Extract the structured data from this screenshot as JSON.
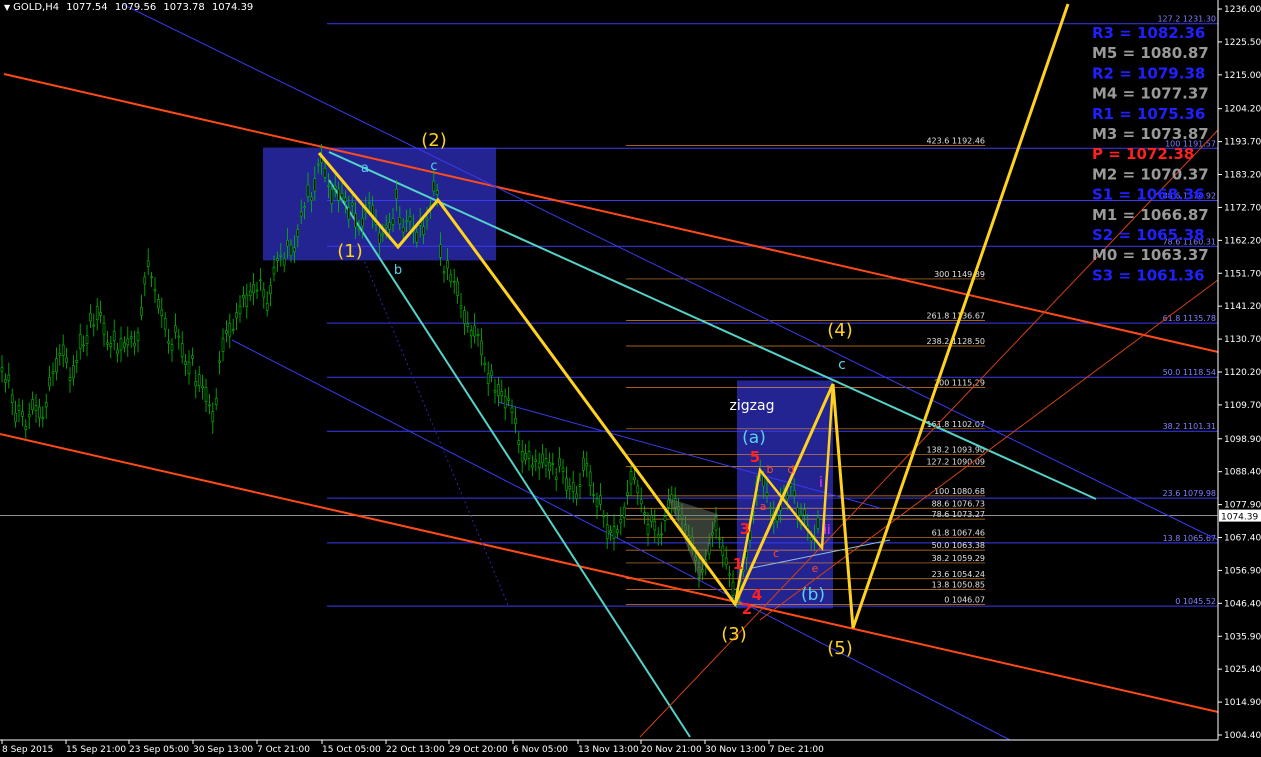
{
  "header": {
    "symbol": "GOLD,H4",
    "open": "1077.54",
    "high": "1079.56",
    "low": "1073.78",
    "close": "1074.39"
  },
  "colors": {
    "background": "#000000",
    "candle": "#00c000",
    "wave_line": "#ffd21e",
    "channel_red": "#ff4a1a",
    "channel_cyan": "#55d2c8",
    "fib_line": "#3a3af0",
    "fib_orange": "#ff9b30",
    "pivot_blue": "#2020ff",
    "pivot_grey": "#9a9a9a",
    "pivot_red": "#ff2020",
    "box": "#232391"
  },
  "chart_data": {
    "type": "candlestick",
    "instrument": "GOLD",
    "timeframe": "H4",
    "ylim": [
      1004.4,
      1236.0
    ],
    "y_ticks": [
      "1236.00",
      "1225.50",
      "1215.00",
      "1204.20",
      "1193.70",
      "1183.20",
      "1172.70",
      "1162.20",
      "1151.70",
      "1141.20",
      "1130.70",
      "1120.20",
      "1109.70",
      "1098.90",
      "1088.40",
      "1077.90",
      "1067.40",
      "1056.90",
      "1046.40",
      "1035.90",
      "1025.40",
      "1014.90",
      "1004.40"
    ],
    "current_price": "1074.39",
    "x_ticks": [
      "8 Sep 2015",
      "15 Sep 21:00",
      "23 Sep 05:00",
      "30 Sep 13:00",
      "7 Oct 21:00",
      "15 Oct 05:00",
      "22 Oct 13:00",
      "29 Oct 20:00",
      "6 Nov 05:00",
      "13 Nov 13:00",
      "20 Nov 21:00",
      "30 Nov 13:00",
      "7 Dec 21:00"
    ],
    "price_path": [
      [
        0,
        1126
      ],
      [
        4,
        1116
      ],
      [
        8,
        1120
      ],
      [
        12,
        1112
      ],
      [
        16,
        1105
      ],
      [
        20,
        1110
      ],
      [
        26,
        1102
      ],
      [
        32,
        1110
      ],
      [
        38,
        1108
      ],
      [
        44,
        1105
      ],
      [
        50,
        1118
      ],
      [
        56,
        1122
      ],
      [
        62,
        1128
      ],
      [
        66,
        1125
      ],
      [
        70,
        1118
      ],
      [
        76,
        1122
      ],
      [
        80,
        1130
      ],
      [
        86,
        1128
      ],
      [
        90,
        1138
      ],
      [
        94,
        1135
      ],
      [
        98,
        1140
      ],
      [
        102,
        1138
      ],
      [
        106,
        1130
      ],
      [
        110,
        1128
      ],
      [
        114,
        1132
      ],
      [
        118,
        1126
      ],
      [
        122,
        1130
      ],
      [
        126,
        1128
      ],
      [
        130,
        1132
      ],
      [
        136,
        1128
      ],
      [
        140,
        1135
      ],
      [
        144,
        1148
      ],
      [
        148,
        1155
      ],
      [
        152,
        1150
      ],
      [
        156,
        1145
      ],
      [
        160,
        1140
      ],
      [
        164,
        1138
      ],
      [
        168,
        1130
      ],
      [
        172,
        1128
      ],
      [
        176,
        1135
      ],
      [
        180,
        1130
      ],
      [
        184,
        1125
      ],
      [
        188,
        1120
      ],
      [
        192,
        1126
      ],
      [
        196,
        1116
      ],
      [
        200,
        1118
      ],
      [
        204,
        1114
      ],
      [
        208,
        1112
      ],
      [
        212,
        1105
      ],
      [
        216,
        1110
      ],
      [
        220,
        1125
      ],
      [
        224,
        1130
      ],
      [
        228,
        1135
      ],
      [
        232,
        1132
      ],
      [
        236,
        1138
      ],
      [
        240,
        1140
      ],
      [
        244,
        1145
      ],
      [
        248,
        1142
      ],
      [
        252,
        1148
      ],
      [
        256,
        1145
      ],
      [
        260,
        1150
      ],
      [
        264,
        1145
      ],
      [
        268,
        1140
      ],
      [
        272,
        1150
      ],
      [
        276,
        1155
      ],
      [
        280,
        1158
      ],
      [
        284,
        1155
      ],
      [
        288,
        1162
      ],
      [
        292,
        1158
      ],
      [
        296,
        1160
      ],
      [
        300,
        1170
      ],
      [
        304,
        1172
      ],
      [
        308,
        1178
      ],
      [
        312,
        1175
      ],
      [
        316,
        1182
      ],
      [
        320,
        1190
      ],
      [
        324,
        1185
      ],
      [
        328,
        1180
      ],
      [
        332,
        1176
      ],
      [
        336,
        1180
      ],
      [
        340,
        1175
      ],
      [
        344,
        1178
      ],
      [
        348,
        1170
      ],
      [
        352,
        1174
      ],
      [
        356,
        1168
      ],
      [
        360,
        1165
      ],
      [
        364,
        1170
      ],
      [
        368,
        1175
      ],
      [
        372,
        1172
      ],
      [
        376,
        1168
      ],
      [
        380,
        1162
      ],
      [
        384,
        1165
      ],
      [
        388,
        1168
      ],
      [
        392,
        1165
      ],
      [
        396,
        1178
      ],
      [
        400,
        1168
      ],
      [
        404,
        1165
      ],
      [
        408,
        1170
      ],
      [
        412,
        1168
      ],
      [
        416,
        1162
      ],
      [
        420,
        1168
      ],
      [
        424,
        1165
      ],
      [
        428,
        1170
      ],
      [
        432,
        1175
      ],
      [
        436,
        1185
      ],
      [
        440,
        1160
      ],
      [
        444,
        1152
      ],
      [
        448,
        1155
      ],
      [
        452,
        1148
      ],
      [
        456,
        1150
      ],
      [
        460,
        1142
      ],
      [
        464,
        1138
      ],
      [
        468,
        1135
      ],
      [
        472,
        1132
      ],
      [
        476,
        1134
      ],
      [
        480,
        1130
      ],
      [
        484,
        1124
      ],
      [
        488,
        1118
      ],
      [
        492,
        1120
      ],
      [
        496,
        1112
      ],
      [
        500,
        1116
      ],
      [
        504,
        1110
      ],
      [
        508,
        1112
      ],
      [
        512,
        1108
      ],
      [
        516,
        1104
      ],
      [
        520,
        1095
      ],
      [
        524,
        1092
      ],
      [
        528,
        1095
      ],
      [
        532,
        1090
      ],
      [
        536,
        1092
      ],
      [
        540,
        1090
      ],
      [
        544,
        1094
      ],
      [
        548,
        1089
      ],
      [
        552,
        1092
      ],
      [
        556,
        1086
      ],
      [
        560,
        1092
      ],
      [
        564,
        1088
      ],
      [
        568,
        1082
      ],
      [
        572,
        1085
      ],
      [
        576,
        1080
      ],
      [
        580,
        1084
      ],
      [
        584,
        1092
      ],
      [
        588,
        1090
      ],
      [
        592,
        1083
      ],
      [
        596,
        1078
      ],
      [
        600,
        1080
      ],
      [
        604,
        1074
      ],
      [
        608,
        1068
      ],
      [
        612,
        1070
      ],
      [
        616,
        1068
      ],
      [
        620,
        1072
      ],
      [
        624,
        1075
      ],
      [
        628,
        1082
      ],
      [
        632,
        1088
      ],
      [
        636,
        1085
      ],
      [
        640,
        1080
      ],
      [
        644,
        1076
      ],
      [
        648,
        1070
      ],
      [
        652,
        1074
      ],
      [
        656,
        1070
      ],
      [
        660,
        1066
      ],
      [
        664,
        1072
      ],
      [
        668,
        1078
      ],
      [
        672,
        1080
      ],
      [
        676,
        1078
      ],
      [
        680,
        1076
      ],
      [
        684,
        1072
      ],
      [
        688,
        1068
      ],
      [
        692,
        1066
      ],
      [
        696,
        1060
      ],
      [
        700,
        1055
      ],
      [
        704,
        1058
      ],
      [
        708,
        1062
      ],
      [
        712,
        1068
      ],
      [
        716,
        1072
      ],
      [
        720,
        1066
      ],
      [
        724,
        1062
      ],
      [
        728,
        1058
      ],
      [
        732,
        1052
      ],
      [
        736,
        1048
      ],
      [
        740,
        1052
      ],
      [
        744,
        1058
      ],
      [
        748,
        1064
      ],
      [
        752,
        1072
      ],
      [
        756,
        1082
      ],
      [
        760,
        1088
      ],
      [
        764,
        1085
      ],
      [
        768,
        1080
      ],
      [
        772,
        1075
      ],
      [
        776,
        1072
      ],
      [
        780,
        1077
      ],
      [
        784,
        1082
      ],
      [
        788,
        1080
      ],
      [
        792,
        1086
      ],
      [
        796,
        1078
      ],
      [
        800,
        1072
      ],
      [
        804,
        1076
      ],
      [
        808,
        1070
      ],
      [
        812,
        1066
      ],
      [
        816,
        1068
      ],
      [
        820,
        1076
      ],
      [
        822,
        1078
      ]
    ],
    "waves": [
      {
        "label": "(1)",
        "color": "#ffd21e"
      },
      {
        "label": "(2)",
        "color": "#ffd21e"
      },
      {
        "label": "(3)",
        "color": "#ffd21e"
      },
      {
        "label": "(4)",
        "color": "#ffd21e"
      },
      {
        "label": "(5)",
        "color": "#ffd21e"
      },
      {
        "label": "a",
        "color": "#55d2f0"
      },
      {
        "label": "b",
        "color": "#55d2f0"
      },
      {
        "label": "c",
        "color": "#55d2f0"
      },
      {
        "label": "c",
        "color": "#55d2f0"
      },
      {
        "label": "(a)",
        "color": "#55d2f0"
      },
      {
        "label": "(b)",
        "color": "#55d2f0"
      },
      {
        "label": "zigzag",
        "color": "#ffffff"
      },
      {
        "label": "1",
        "color": "#ff2020"
      },
      {
        "label": "2",
        "color": "#ff2020"
      },
      {
        "label": "3",
        "color": "#ff2020"
      },
      {
        "label": "4",
        "color": "#ff2020"
      },
      {
        "label": "5",
        "color": "#ff2020"
      },
      {
        "label": "a",
        "color": "#ff4a2a"
      },
      {
        "label": "b",
        "color": "#ff4a2a"
      },
      {
        "label": "c",
        "color": "#ff4a2a"
      },
      {
        "label": "d",
        "color": "#ff4a2a"
      },
      {
        "label": "e",
        "color": "#ff4a2a"
      },
      {
        "label": "i",
        "color": "#ff30ff"
      },
      {
        "label": "ii",
        "color": "#ff30ff"
      }
    ],
    "fib_right": [
      {
        "label": "127.2 1231.30",
        "price": 1231.3
      },
      {
        "label": "100 1191.57",
        "price": 1191.57
      },
      {
        "label": "88.6 1174.92",
        "price": 1174.92
      },
      {
        "label": "78.6 1160.31",
        "price": 1160.31
      },
      {
        "label": "61.8 1135.78",
        "price": 1135.78
      },
      {
        "label": "50.0 1118.54",
        "price": 1118.54
      },
      {
        "label": "38.2 1101.31",
        "price": 1101.31
      },
      {
        "label": "23.6 1079.98",
        "price": 1079.98
      },
      {
        "label": "13.8 1065.67",
        "price": 1065.67
      },
      {
        "label": "0 1045.52",
        "price": 1045.52
      }
    ],
    "fib_mid": [
      {
        "label": "423.6 1192.46",
        "price": 1192.46
      },
      {
        "label": "300 1149.89",
        "price": 1149.89
      },
      {
        "label": "261.8 1136.67",
        "price": 1136.67
      },
      {
        "label": "238.2 1128.50",
        "price": 1128.5
      },
      {
        "label": "200 1115.29",
        "price": 1115.29
      },
      {
        "label": "161.8 1102.07",
        "price": 1102.07
      },
      {
        "label": "138.2 1093.90",
        "price": 1093.9
      },
      {
        "label": "127.2 1090.09",
        "price": 1090.09
      },
      {
        "label": "100 1080.68",
        "price": 1080.68
      },
      {
        "label": "88.6 1076.73",
        "price": 1076.73
      },
      {
        "label": "78.6 1073.27",
        "price": 1073.27
      },
      {
        "label": "61.8 1067.46",
        "price": 1067.46
      },
      {
        "label": "50.0 1063.38",
        "price": 1063.38
      },
      {
        "label": "38.2 1059.29",
        "price": 1059.29
      },
      {
        "label": "23.6 1054.24",
        "price": 1054.24
      },
      {
        "label": "13.8 1050.85",
        "price": 1050.85
      },
      {
        "label": "0 1046.07",
        "price": 1046.07
      }
    ],
    "pivots": [
      {
        "label": "R3 = 1082.36",
        "color": "#2020ff"
      },
      {
        "label": "M5 = 1080.87",
        "color": "#9a9a9a"
      },
      {
        "label": "R2 = 1079.38",
        "color": "#2020ff"
      },
      {
        "label": "M4 = 1077.37",
        "color": "#9a9a9a"
      },
      {
        "label": "R1 = 1075.36",
        "color": "#2020ff"
      },
      {
        "label": "M3 = 1073.87",
        "color": "#9a9a9a"
      },
      {
        "label": "P = 1072.38",
        "color": "#ff2020"
      },
      {
        "label": "M2 = 1070.37",
        "color": "#9a9a9a"
      },
      {
        "label": "S1 = 1068.36",
        "color": "#2020ff"
      },
      {
        "label": "M1 = 1066.87",
        "color": "#9a9a9a"
      },
      {
        "label": "S2 = 1065.38",
        "color": "#2020ff"
      },
      {
        "label": "M0 = 1063.37",
        "color": "#9a9a9a"
      },
      {
        "label": "S3 = 1061.36",
        "color": "#2020ff"
      }
    ]
  }
}
